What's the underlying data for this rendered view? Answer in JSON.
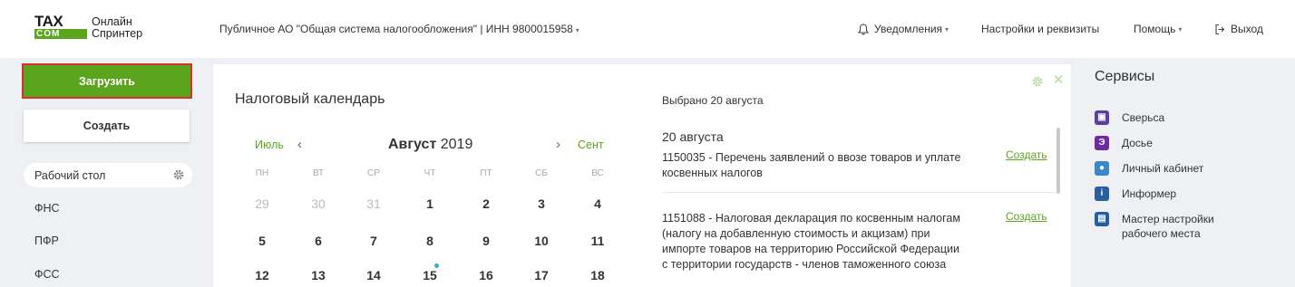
{
  "logo": {
    "mark_top": "TAX",
    "mark_bottom": "COM",
    "line1": "Онлайн",
    "line2": "Спринтер"
  },
  "header": {
    "org": "Публичное АО \"Общая система налогообложения\" | ИНН 9800015958",
    "notifications": "Уведомления",
    "settings": "Настройки и реквизиты",
    "help": "Помощь",
    "logout": "Выход"
  },
  "sidebar": {
    "upload": "Загрузить",
    "create": "Создать",
    "desk": "Рабочий стол",
    "items": [
      "ФНС",
      "ПФР",
      "ФСС"
    ]
  },
  "calendar": {
    "title": "Налоговый календарь",
    "prev_month": "Июль",
    "next_month": "Сент",
    "month": "Август",
    "year": "2019",
    "weekdays": [
      "ПН",
      "ВТ",
      "СР",
      "ЧТ",
      "ПТ",
      "СБ",
      "ВС"
    ],
    "rows": [
      [
        "29",
        "30",
        "31",
        "1",
        "2",
        "3",
        "4"
      ],
      [
        "5",
        "6",
        "7",
        "8",
        "9",
        "10",
        "11"
      ],
      [
        "12",
        "13",
        "14",
        "15",
        "16",
        "17",
        "18"
      ]
    ],
    "muted_first_row_count": 3,
    "dot_day": "15"
  },
  "events": {
    "selected": "Выбрано 20 августа",
    "date": "20 августа",
    "items": [
      {
        "text": "1150035 - Перечень заявлений о ввозе товаров и уплате\nкосвенных налогов",
        "action": "Создать"
      },
      {
        "text": "1151088 - Налоговая декларация по косвенным налогам\n(налогу на добавленную стоимость и акцизам) при\nимпорте товаров на территорию Российской Федерации\nс территории государств - членов таможенного союза",
        "action": "Создать"
      }
    ]
  },
  "services": {
    "title": "Сервисы",
    "items": [
      {
        "label": "Сверьса",
        "icon": "reconcile-icon",
        "color": "#5b3fa0"
      },
      {
        "label": "Досье",
        "icon": "dossier-icon",
        "color": "#6a2ca0"
      },
      {
        "label": "Личный кабинет",
        "icon": "user-icon",
        "color": "#3a88c8"
      },
      {
        "label": "Информер",
        "icon": "info-icon",
        "color": "#2a5f9e"
      },
      {
        "label": "Мастер настройки\nрабочего места",
        "icon": "wizard-icon",
        "color": "#1f5fa8"
      }
    ]
  },
  "colors": {
    "accent": "#5aa51d",
    "highlight": "#d9312a",
    "dot": "#2eb3c7"
  }
}
